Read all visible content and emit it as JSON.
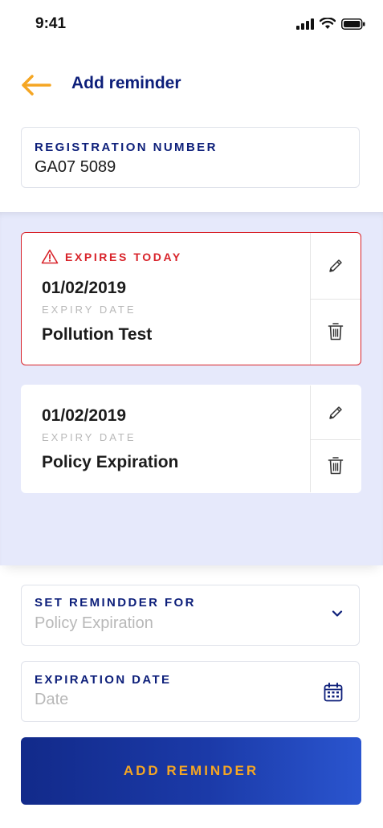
{
  "status_bar": {
    "time": "9:41"
  },
  "header": {
    "title": "Add reminder"
  },
  "registration": {
    "label": "REGISTRATION NUMBER",
    "value": "GA07 5089"
  },
  "reminders": [
    {
      "warning": "EXPIRES TODAY",
      "date": "01/02/2019",
      "date_label": "EXPIRY DATE",
      "type": "Pollution Test"
    },
    {
      "date": "01/02/2019",
      "date_label": "EXPIRY DATE",
      "type": "Policy Expiration"
    }
  ],
  "set_reminder": {
    "label": "SET REMINDDER FOR",
    "value": "Policy Expiration"
  },
  "expiration_date": {
    "label": "EXPIRATION DATE",
    "placeholder": "Date"
  },
  "add_button": {
    "label": "ADD REMINDER"
  },
  "colors": {
    "primary": "#0d1f7a",
    "accent": "#f5a623",
    "danger": "#d8232a",
    "list_bg": "#e6e9fb"
  },
  "icons": {
    "back": "arrow-left-icon",
    "warning": "warning-triangle-icon",
    "edit": "pencil-icon",
    "delete": "trash-icon",
    "dropdown": "chevron-down-icon",
    "calendar": "calendar-icon"
  }
}
